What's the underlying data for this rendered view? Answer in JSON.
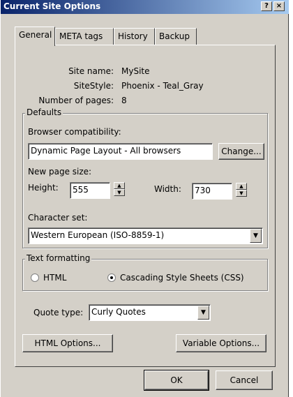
{
  "window": {
    "title": "Current Site Options",
    "help_label": "?",
    "close_label": "×"
  },
  "tabs": [
    {
      "label": "General"
    },
    {
      "label": "META tags"
    },
    {
      "label": "History"
    },
    {
      "label": "Backup"
    }
  ],
  "info": {
    "site_name_label": "Site name:",
    "site_name_value": "MySite",
    "site_style_label": "SiteStyle:",
    "site_style_value": "Phoenix - Teal_Gray",
    "pages_label": "Number of pages:",
    "pages_value": "8"
  },
  "defaults": {
    "legend": "Defaults",
    "compat_label": "Browser compatibility:",
    "compat_value": "Dynamic Page Layout - All browsers",
    "change_button": "Change...",
    "page_size_label": "New page size:",
    "height_label": "Height:",
    "height_value": "555",
    "width_label": "Width:",
    "width_value": "730",
    "charset_label": "Character set:",
    "charset_value": "Western European (ISO-8859-1)"
  },
  "text_formatting": {
    "legend": "Text formatting",
    "html_label": "HTML",
    "css_label": "Cascading Style Sheets (CSS)",
    "selected": "css"
  },
  "quote": {
    "label": "Quote type:",
    "value": "Curly Quotes"
  },
  "buttons": {
    "html_options": "HTML Options...",
    "variable_options": "Variable Options...",
    "ok": "OK",
    "cancel": "Cancel"
  },
  "colors": {
    "titlebar_start": "#0a246a",
    "titlebar_end": "#a6caf0",
    "face": "#d4d0c8"
  }
}
